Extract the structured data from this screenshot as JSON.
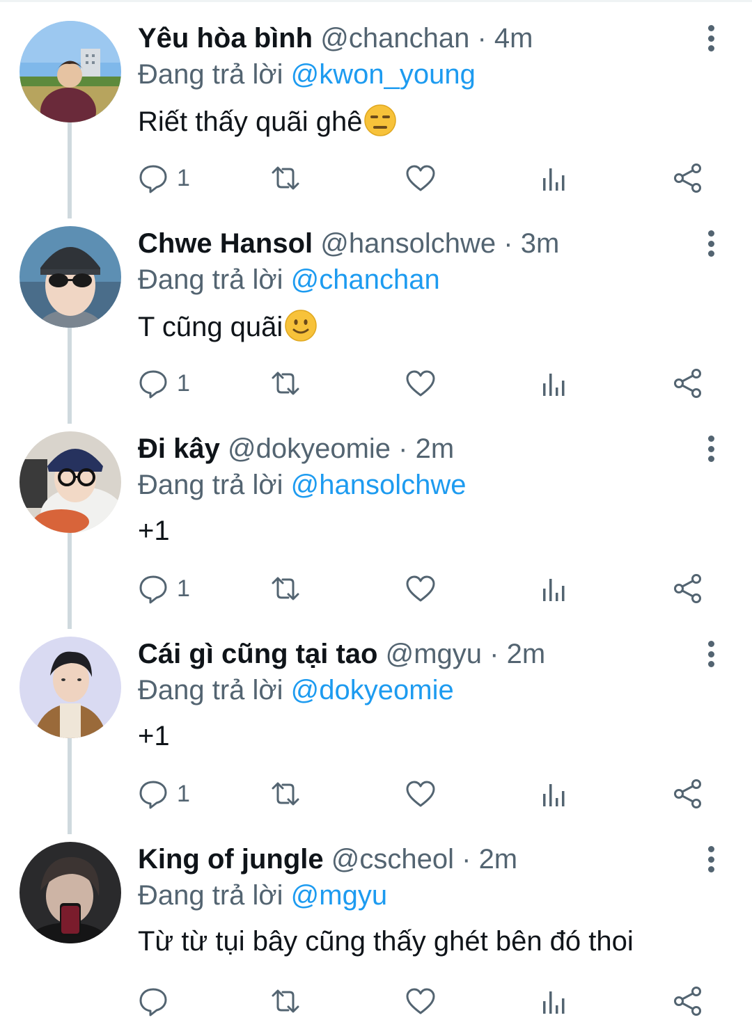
{
  "reply_label": "Đang trả lời",
  "tweets": [
    {
      "name": "Yêu hòa bình",
      "handle": "@chanchan",
      "separator": "·",
      "time": "4m",
      "reply_to": "@kwon_young",
      "text": "Riết thấy quãi ghê",
      "emoji": "expressionless-face",
      "reply_count": "1"
    },
    {
      "name": "Chwe Hansol",
      "handle": "@hansolchwe",
      "separator": "·",
      "time": "3m",
      "reply_to": "@chanchan",
      "text": "T cũng quãi",
      "emoji": "slightly-smiling-face",
      "reply_count": "1"
    },
    {
      "name": "Đi kây",
      "handle": "@dokyeomie",
      "separator": "·",
      "time": "2m",
      "reply_to": "@hansolchwe",
      "text": "+1",
      "emoji": "",
      "reply_count": "1"
    },
    {
      "name": "Cái gì cũng tại tao",
      "handle": "@mgyu",
      "separator": "·",
      "time": "2m",
      "reply_to": "@dokyeomie",
      "text": "+1",
      "emoji": "",
      "reply_count": "1"
    },
    {
      "name": "King of jungle",
      "handle": "@cscheol",
      "separator": "·",
      "time": "2m",
      "reply_to": "@mgyu",
      "text": "Từ từ tụi bây cũng thấy ghét bên đó thoi",
      "emoji": "",
      "reply_count": ""
    }
  ],
  "colors": {
    "link": "#1d9bf0",
    "secondary_text": "#536471",
    "thread_line": "#cfd9de",
    "primary_text": "#0f1419"
  },
  "icons": {
    "reply": "reply-icon",
    "retweet": "retweet-icon",
    "like": "heart-icon",
    "views": "views-icon",
    "share": "share-icon",
    "more": "more-icon"
  }
}
